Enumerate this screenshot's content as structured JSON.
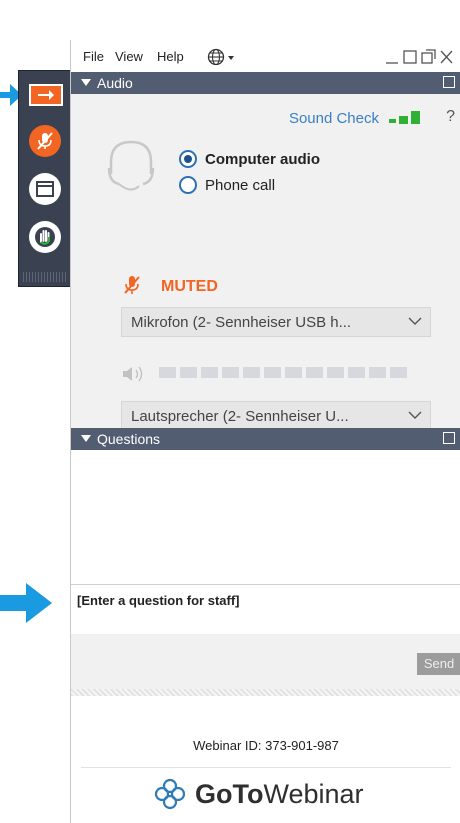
{
  "menubar": {
    "items": [
      "File",
      "View",
      "Help"
    ],
    "window_controls": [
      "minimize",
      "restore",
      "popout",
      "close"
    ]
  },
  "audio_panel": {
    "title": "Audio",
    "sound_check_label": "Sound Check",
    "help_label": "?",
    "options": [
      {
        "label": "Computer audio",
        "selected": true
      },
      {
        "label": "Phone call",
        "selected": false
      }
    ],
    "mute_status": "MUTED",
    "microphone_select": "Mikrofon (2- Sennheiser USB h...",
    "speaker_select": "Lautsprecher (2- Sennheiser U...",
    "speaker_level_segments": 12,
    "speaker_level_active": 0
  },
  "questions_panel": {
    "title": "Questions",
    "input_placeholder": "[Enter a question for staff]",
    "send_label": "Send"
  },
  "footer": {
    "webinar_id": "Webinar ID: 373-901-987",
    "brand_goto": "GoTo",
    "brand_webinar": "Webinar"
  },
  "colors": {
    "accent_orange": "#f26522",
    "panel_header": "#535d71",
    "dock_bg": "#3a4251",
    "link_blue": "#3a7fc4",
    "level_green": "#2eb135",
    "annotation_arrow": "#1a9ae0",
    "brand_logo": "#2f7cb8"
  },
  "icons": [
    "arrow-right-icon",
    "microphone-muted-icon",
    "window-icon",
    "raise-hand-icon",
    "globe-icon",
    "headset-icon",
    "speaker-icon",
    "chevron-down-icon",
    "popout-icon",
    "gotowebinar-logo-icon"
  ]
}
